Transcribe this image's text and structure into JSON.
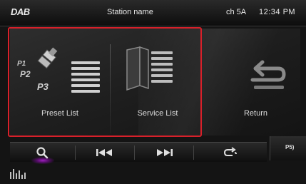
{
  "status_bar": {
    "source": "DAB",
    "station": "Station name",
    "channel": "ch 5A",
    "clock": "12:34 PM"
  },
  "menu": {
    "preset_list": {
      "label": "Preset List",
      "icon": "preset-list-icon",
      "icon_text": [
        "P1",
        "P2",
        "P3"
      ]
    },
    "service_list": {
      "label": "Service List",
      "icon": "service-list-icon"
    },
    "return": {
      "label": "Return",
      "icon": "return-icon"
    }
  },
  "controls": {
    "search_icon": "search-icon",
    "prev_icon": "skip-back-icon",
    "next_icon": "skip-forward-icon",
    "repeat_icon": "repeat-icon"
  },
  "preset_indicator": "P5)",
  "eq_icon": "equalizer-icon",
  "colors": {
    "highlight": "#d8202a",
    "search_active": "#a020c0"
  }
}
